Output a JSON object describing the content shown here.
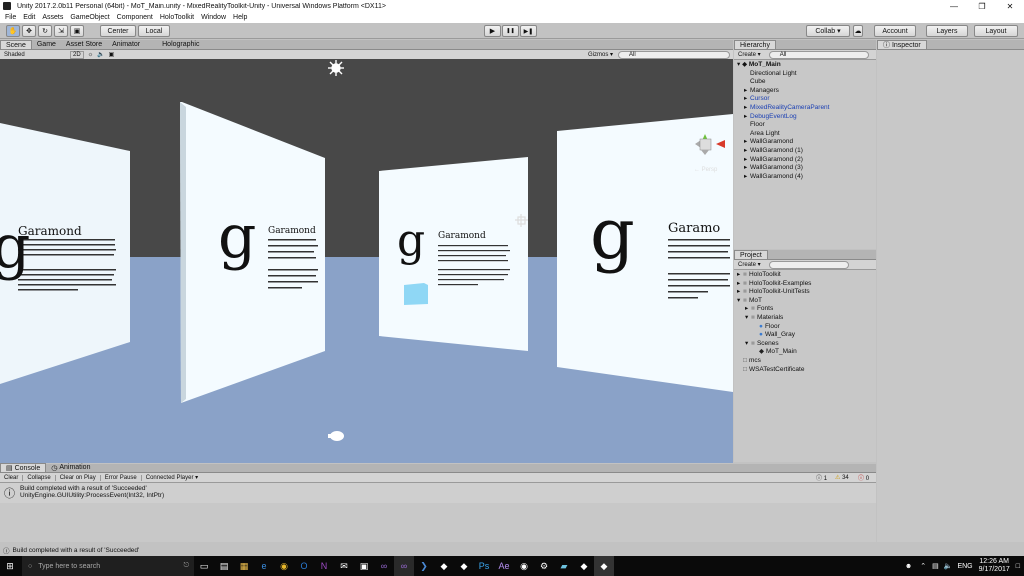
{
  "window": {
    "title": "Unity 2017.2.0b11 Personal (64bit) - MoT_Main.unity - MixedRealityToolkit-Unity - Universal Windows Platform <DX11>",
    "minimize": "—",
    "maximize": "❐",
    "close": "✕"
  },
  "menu": [
    "File",
    "Edit",
    "Assets",
    "GameObject",
    "Component",
    "HoloToolkit",
    "Window",
    "Help"
  ],
  "toolbar": {
    "pivot": "Center",
    "space": "Local",
    "play": "▶",
    "pause": "❚❚",
    "step": "▶❚",
    "collab": "Collab ▾",
    "account": "Account",
    "layers": "Layers",
    "layout": "Layout"
  },
  "scene_tabs": [
    "Scene",
    "Game",
    "Asset Store",
    "Animator",
    "Holographic"
  ],
  "scene_bar": {
    "shading": "Shaded",
    "mode_2d": "2D",
    "gizmos": "Gizmos ▾",
    "search": "All",
    "persp": "← Persp"
  },
  "walls": [
    {
      "title": "Garamond",
      "letter": "g"
    },
    {
      "title": "Garamond",
      "letter": "g"
    },
    {
      "title": "Garamond",
      "letter": "g"
    },
    {
      "title": "Garamo",
      "letter": "g"
    }
  ],
  "hierarchy": {
    "tab": "Hierarchy",
    "create": "Create ▾",
    "search": "All",
    "scene": "MoT_Main",
    "items": [
      {
        "label": "Directional Light",
        "arrow": "",
        "blue": false
      },
      {
        "label": "Cube",
        "arrow": "",
        "blue": false
      },
      {
        "label": "Managers",
        "arrow": "▸",
        "blue": false
      },
      {
        "label": "Cursor",
        "arrow": "▸",
        "blue": true
      },
      {
        "label": "MixedRealityCameraParent",
        "arrow": "▸",
        "blue": true
      },
      {
        "label": "DebugEventLog",
        "arrow": "▸",
        "blue": true
      },
      {
        "label": "Floor",
        "arrow": "",
        "blue": false
      },
      {
        "label": "Area Light",
        "arrow": "",
        "blue": false
      },
      {
        "label": "WallGaramond",
        "arrow": "▸",
        "blue": false
      },
      {
        "label": "WallGaramond (1)",
        "arrow": "▸",
        "blue": false
      },
      {
        "label": "WallGaramond (2)",
        "arrow": "▸",
        "blue": false
      },
      {
        "label": "WallGaramond (3)",
        "arrow": "▸",
        "blue": false
      },
      {
        "label": "WallGaramond (4)",
        "arrow": "▸",
        "blue": false
      }
    ]
  },
  "inspector": {
    "tab": "Inspector"
  },
  "project": {
    "tab": "Project",
    "create": "Create ▾",
    "items": [
      {
        "label": "HoloToolkit",
        "depth": 0,
        "arrow": "▸",
        "icon": "folder"
      },
      {
        "label": "HoloToolkit-Examples",
        "depth": 0,
        "arrow": "▸",
        "icon": "folder"
      },
      {
        "label": "HoloToolkit-UnitTests",
        "depth": 0,
        "arrow": "▸",
        "icon": "folder"
      },
      {
        "label": "MoT",
        "depth": 0,
        "arrow": "▾",
        "icon": "folder"
      },
      {
        "label": "Fonts",
        "depth": 1,
        "arrow": "▸",
        "icon": "folder"
      },
      {
        "label": "Materials",
        "depth": 1,
        "arrow": "▾",
        "icon": "folder"
      },
      {
        "label": "Floor",
        "depth": 2,
        "arrow": "",
        "icon": "material"
      },
      {
        "label": "Wall_Gray",
        "depth": 2,
        "arrow": "",
        "icon": "material"
      },
      {
        "label": "Scenes",
        "depth": 1,
        "arrow": "▾",
        "icon": "folder"
      },
      {
        "label": "MoT_Main",
        "depth": 2,
        "arrow": "",
        "icon": "unity"
      },
      {
        "label": "mcs",
        "depth": 0,
        "arrow": "",
        "icon": "file"
      },
      {
        "label": "WSATestCertificate",
        "depth": 0,
        "arrow": "",
        "icon": "file"
      }
    ]
  },
  "console": {
    "tabs": [
      "Console",
      "Animation"
    ],
    "buttons": [
      "Clear",
      "Collapse",
      "Clear on Play",
      "Error Pause",
      "Connected Player ▾"
    ],
    "counts": {
      "info": "1",
      "warn": "34",
      "error": "0"
    },
    "line1": "Build completed with a result of 'Succeeded'",
    "line2": "UnityEngine.GUIUtility:ProcessEvent(Int32, IntPtr)"
  },
  "status": "Build completed with a result of 'Succeeded'",
  "taskbar": {
    "search": "Type here to search",
    "lang": "ENG",
    "time": "12:26 AM",
    "date": "9/17/2017"
  },
  "colors": {
    "sky": "#484848",
    "floor": "#8aa2c8",
    "wall": "#f2fafe",
    "cube": "#8fd7f5",
    "blue_text": "#1a3fb3"
  }
}
